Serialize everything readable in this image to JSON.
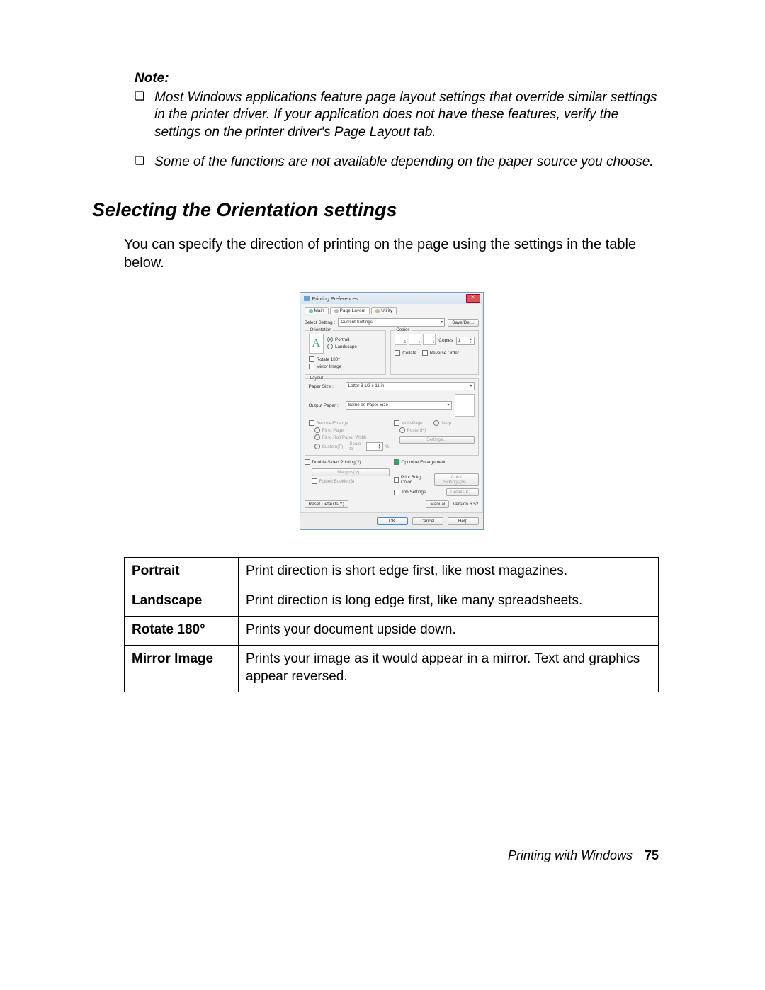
{
  "note": {
    "label": "Note:",
    "items": [
      "Most Windows applications feature page layout settings that override similar settings in the printer driver. If your application does not have these features, verify the settings on the printer driver's Page Layout tab.",
      "Some of the functions are not available depending on the paper source you choose."
    ]
  },
  "heading": "Selecting the Orientation settings",
  "body_intro": "You can specify the direction of printing on the page using the settings in the table below.",
  "dialog": {
    "title": "Printing Preferences",
    "tabs": {
      "main": "Main",
      "page_layout": "Page Layout",
      "utility": "Utility"
    },
    "select_setting_label": "Select Setting :",
    "select_setting_value": "Current Settings",
    "save_del": "Save/Del...",
    "orientation": {
      "group": "Orientation",
      "portrait": "Portrait",
      "landscape": "Landscape",
      "rotate": "Rotate 180°",
      "mirror": "Mirror Image",
      "preview_letter": "A"
    },
    "copies": {
      "group": "Copies",
      "label": "Copies",
      "value": "1",
      "collate": "Collate",
      "reverse": "Reverse Order"
    },
    "layout": {
      "group": "Layout",
      "paper_size_label": "Paper Size :",
      "paper_size_value": "Letter 8 1/2 x 11 in",
      "output_paper_label": "Output Paper :",
      "output_paper_value": "Same as Paper Size",
      "reduce_enlarge": "Reduce/Enlarge",
      "fit_to_page": "Fit to Page",
      "fit_to_roll": "Fit to Roll Paper Width",
      "custom": "Custom(F)",
      "scale_label": "Scale to",
      "multi_page": "Multi-Page",
      "nup": "N-up",
      "poster": "Poster(H)",
      "settings_btn": "Settings..."
    },
    "double_sided": {
      "label": "Double-Sided Printing(2)",
      "margins": "Margins(V)...",
      "folded": "Folded Booklet(3)"
    },
    "optimize": "Optimize Enlargement",
    "bkg": {
      "label": "Print Bckg Color",
      "btn": "Color Settings(H)..."
    },
    "job": {
      "label": "Job Settings",
      "btn": "Details(K)..."
    },
    "reset": "Reset Defaults(Y)",
    "manual": "Manual",
    "version": "Version 6.52",
    "ok": "OK",
    "cancel": "Cancel",
    "help": "Help"
  },
  "table": {
    "rows": [
      {
        "term": "Portrait",
        "desc": "Print direction is short edge first, like most magazines."
      },
      {
        "term": "Landscape",
        "desc": "Print direction is long edge first, like many spreadsheets."
      },
      {
        "term": "Rotate 180°",
        "desc": "Prints your document upside down."
      },
      {
        "term": "Mirror Image",
        "desc": "Prints your image as it would appear in a mirror. Text and graphics appear reversed."
      }
    ]
  },
  "footer": {
    "chapter": "Printing with Windows",
    "page": "75"
  }
}
